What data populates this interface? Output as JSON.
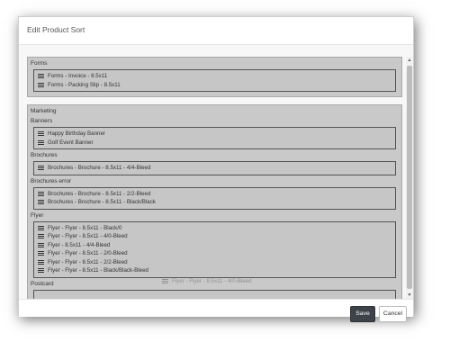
{
  "dialog": {
    "title": "Edit Product Sort"
  },
  "categories": {
    "forms": {
      "label": "Forms",
      "items": [
        "Forms - Invoice - 8.5x11",
        "Forms - Packing Slip - 8.5x11"
      ]
    },
    "marketing": {
      "label": "Marketing",
      "banners": {
        "label": "Banners",
        "items": [
          "Happy Birthday Banner",
          "Golf Event Banner"
        ]
      },
      "brochures": {
        "label": "Brochures",
        "items": [
          "Brochures - Brochure - 8.5x11 - 4/4-Bleed"
        ]
      },
      "brochures_error": {
        "label": "Brochures error",
        "items": [
          "Brochures - Brochure - 8.5x11 - 2/2-Bleed",
          "Brochures - Brochure - 8.5x11 - Black/Black"
        ]
      },
      "flyer": {
        "label": "Flyer",
        "items": [
          "Flyer - Flyer - 8.5x11 - Black/0",
          "Flyer - Flyer - 8.5x11 - 4/0-Bleed",
          "Flyer - 8.5x11 - 4/4-Bleed",
          "Flyer - Flyer - 8.5x11 - 2/0-Bleed",
          "Flyer - Flyer - 8.5x11 - 2/2-Bleed",
          "Flyer - Flyer - 8.5x11 - Black/Black-Bleed"
        ],
        "dragging_item": "Flyer - Flyer - 8.5x11 - 4/0-Bleed"
      },
      "postcard": {
        "label": "Postcard"
      }
    }
  },
  "footer": {
    "save_label": "Save",
    "cancel_label": "Cancel"
  }
}
